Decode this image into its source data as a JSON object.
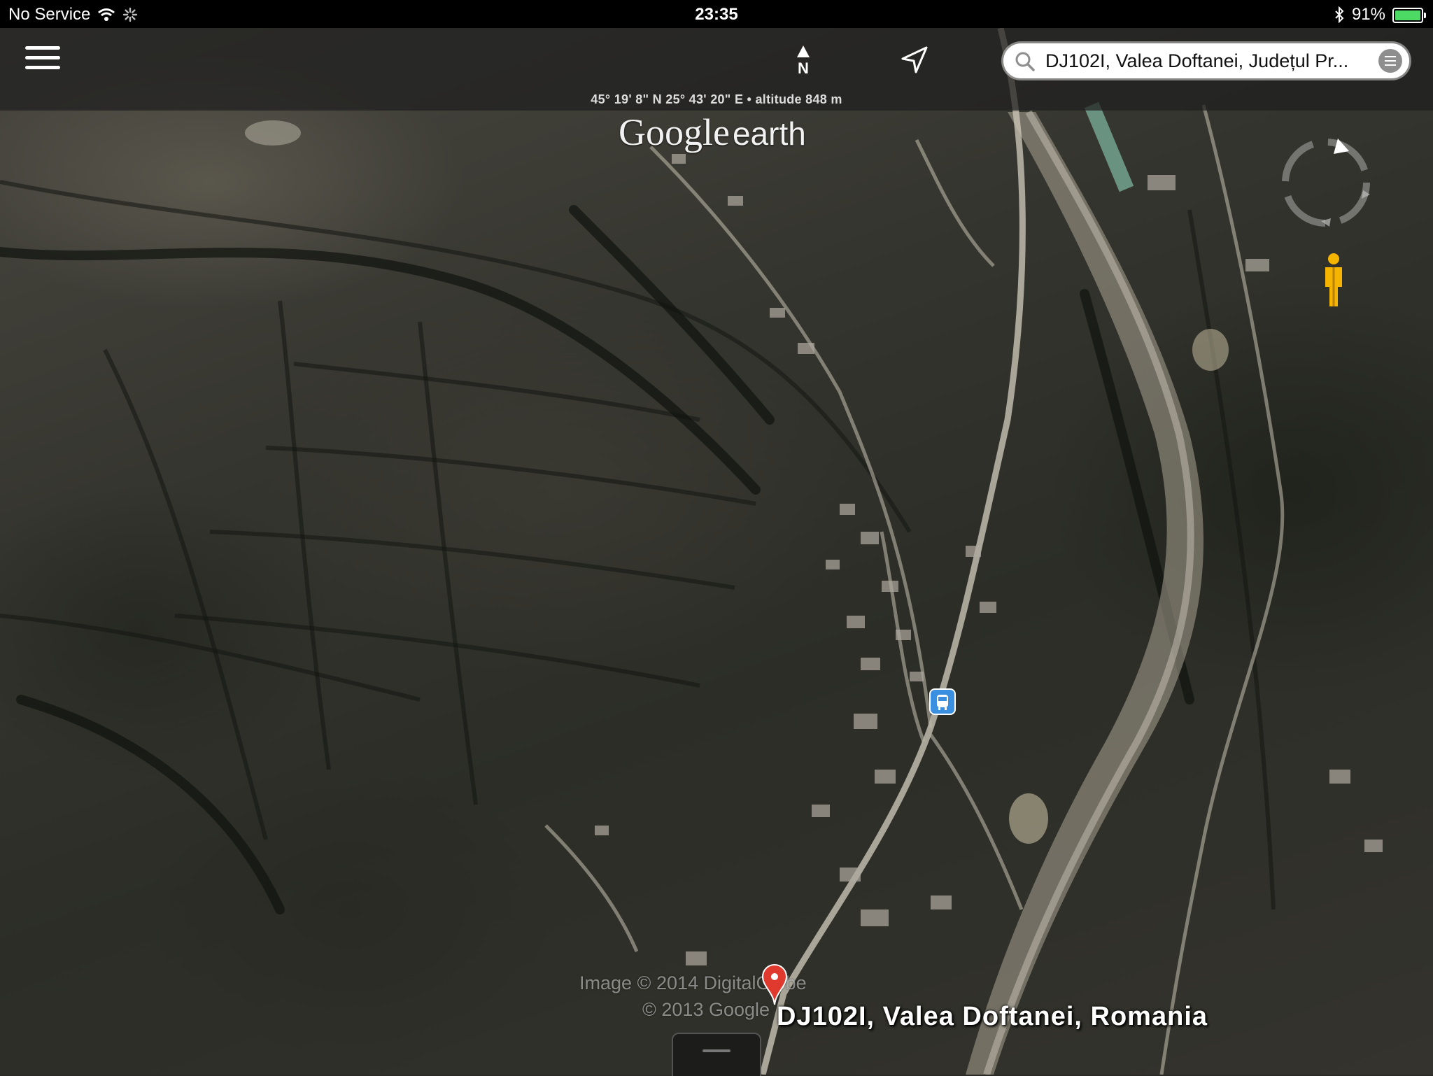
{
  "status_bar": {
    "carrier": "No Service",
    "time": "23:35",
    "battery_text": "91%",
    "battery_level": 0.91,
    "battery_color": "#4cd964"
  },
  "toolbar": {
    "menu_icon": "hamburger-menu-icon",
    "north_label": "N",
    "locate_icon": "location-arrow-icon",
    "search_value": "DJ102I, Valea Doftanei, Județul Pr...",
    "search_icon": "search-icon",
    "list_icon": "list-icon",
    "coordinates": "45° 19' 8\" N  25° 43' 20\" E • altitude 848 m"
  },
  "logo": {
    "google": "Google",
    "earth": "earth"
  },
  "map": {
    "compass_icon": "compass-icon",
    "pegman_icon": "street-view-pegman-icon",
    "transit_icon": "bus-stop-icon",
    "pin_color": "#e03a2f",
    "place_label": "DJ102I, Valea Doftanei, Romania",
    "attribution_line1": "Image © 2014 DigitalGlobe",
    "attribution_line2": "© 2013 Google"
  }
}
